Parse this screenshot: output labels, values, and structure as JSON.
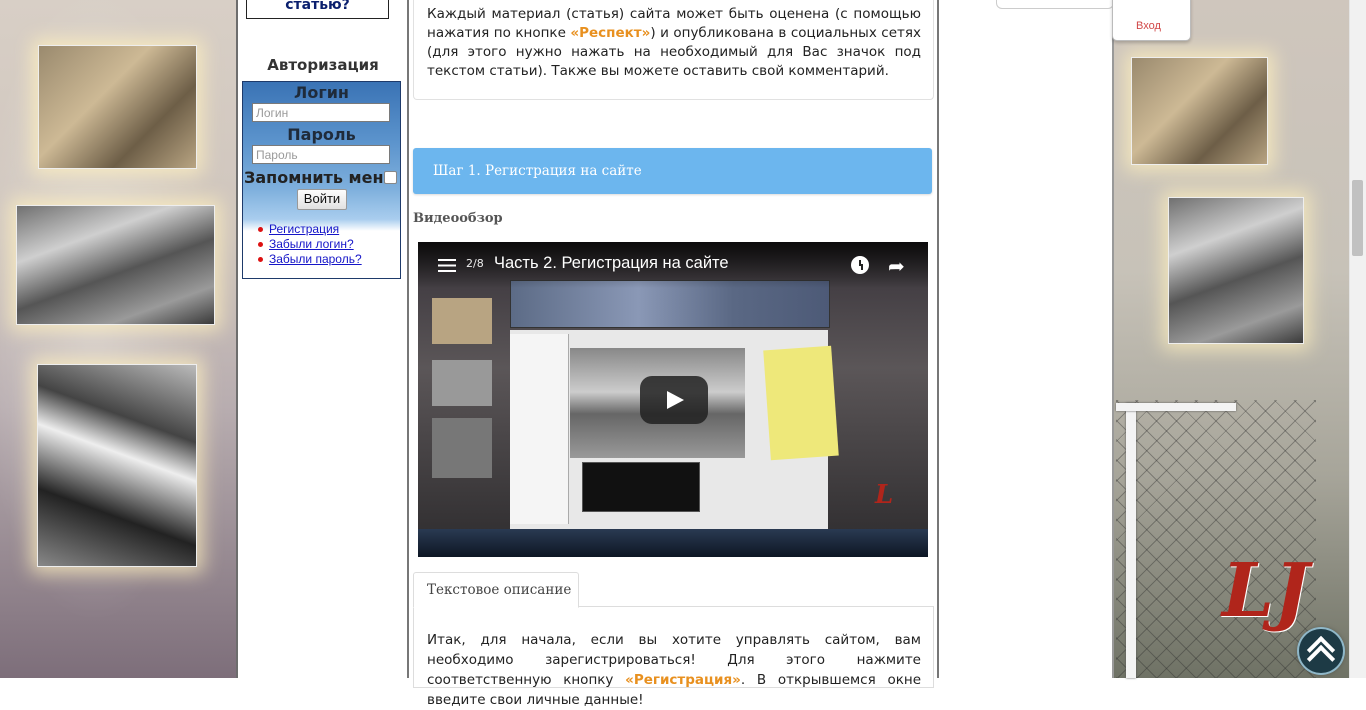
{
  "sidebar": {
    "top_box_text": "статью?",
    "auth_title": "Авторизация",
    "login_label": "Логин",
    "login_placeholder": "Логин",
    "password_label": "Пароль",
    "password_placeholder": "Пароль",
    "remember_label": "Запомнить меня",
    "login_button": "Войти",
    "links": [
      "Регистрация",
      "Забыли логин?",
      "Забыли пароль?"
    ]
  },
  "main": {
    "intro_part1": "Каждый материал (статья) сайта может быть оценена (с помощью нажатия по кнопке ",
    "intro_highlight": "«Респект»",
    "intro_part2": ") и опубликована в социальных сетях (для этого нужно нажать на необходимый для Вас значок под текстом статьи). Также вы можете оставить свой комментарий.",
    "step_title": "Шаг 1. Регистрация на сайте",
    "video_label": "Видеообзор",
    "video": {
      "counter": "2/8",
      "title": "Часть 2. Регистрация на сайте"
    },
    "tab_label": "Текстовое описание",
    "body_part1": "Итак, для начала, если вы хотите управлять сайтом, вам необходимо зарегистрироваться! Для этого нажмите соответственную кнопку ",
    "body_highlight": "«Регистрация»",
    "body_part2": ". В открывшемся окне введите свои личные данные!"
  },
  "header": {
    "login_link": "Вход"
  },
  "colors": {
    "accent_blue": "#6cb6ee",
    "highlight_orange": "#e8901f",
    "login_red": "#d14848"
  }
}
